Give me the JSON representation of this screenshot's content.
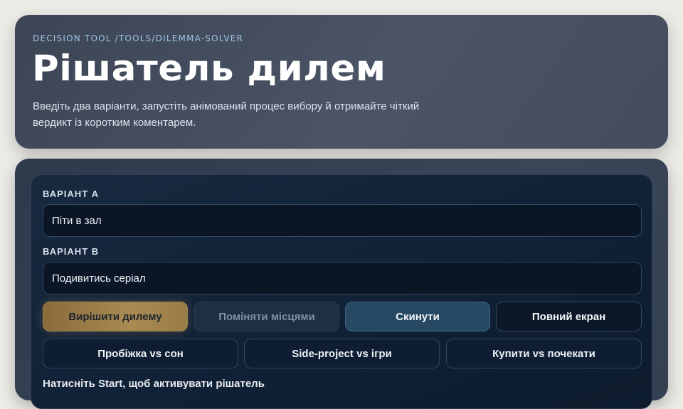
{
  "header": {
    "breadcrumb": "DECISION TOOL /TOOLS/DILEMMA-SOLVER",
    "title": "Рішатель дилем",
    "subtitle_line1": "Введіть два варіанти, запустіть анімований процес вибору й отримайте чіткий",
    "subtitle_line2": "вердикт із коротким коментарем."
  },
  "form": {
    "option_a": {
      "label": "ВАРІАНТ A",
      "value": "Піти в зал"
    },
    "option_b": {
      "label": "ВАРІАНТ B",
      "value": "Подивитись серіал"
    }
  },
  "actions": {
    "solve": "Вирішити дилему",
    "swap": "Поміняти місцями",
    "reset": "Скинути",
    "fullscreen": "Повний екран"
  },
  "presets": [
    {
      "label": "Пробіжка vs сон"
    },
    {
      "label": "Side-project vs ігри"
    },
    {
      "label": "Купити vs почекати"
    }
  ],
  "status": "Натисніть Start, щоб активувати рішатель",
  "colors": {
    "accent_gold": "#a88a52",
    "accent_blue": "#274963",
    "breadcrumb": "#9fc4e4"
  }
}
